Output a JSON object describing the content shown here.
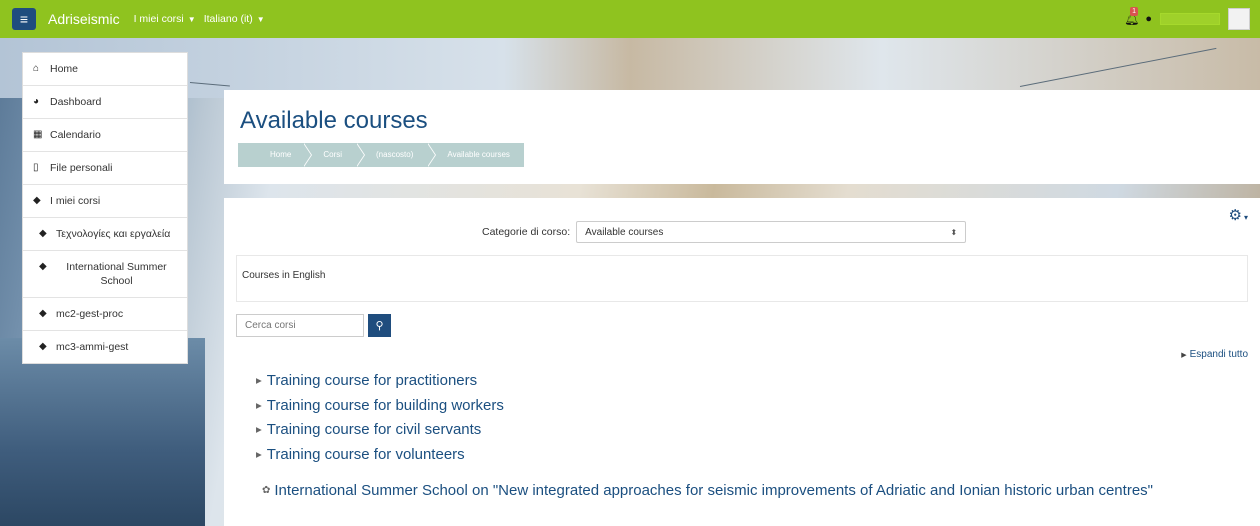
{
  "navbar": {
    "brand": "Adriseismic",
    "my_courses_label": "I miei corsi",
    "language_label": "Italiano (it)",
    "notification_count": "1",
    "colors": {
      "navbar_bg": "#8fc31f",
      "toggle_bg": "#1f4d7e"
    }
  },
  "sidebar": {
    "items": [
      {
        "label": "Home",
        "icon": "home-icon"
      },
      {
        "label": "Dashboard",
        "icon": "dashboard-icon"
      },
      {
        "label": "Calendario",
        "icon": "calendar-icon"
      },
      {
        "label": "File personali",
        "icon": "file-icon"
      },
      {
        "label": "I miei corsi",
        "icon": "graduation-cap-icon"
      },
      {
        "label": "Τεχνολογίες και εργαλεία",
        "icon": "graduation-cap-icon"
      },
      {
        "label": "International Summer School",
        "icon": "graduation-cap-icon"
      },
      {
        "label": "mc2-gest-proc",
        "icon": "graduation-cap-icon"
      },
      {
        "label": "mc3-ammi-gest",
        "icon": "graduation-cap-icon"
      }
    ]
  },
  "header": {
    "title": "Available courses",
    "breadcrumb": [
      "Home",
      "Corsi",
      "(nascosto)",
      "Available courses"
    ]
  },
  "main": {
    "category_label": "Categorie di corso:",
    "category_selected": "Available courses",
    "description": "Courses in English",
    "search_placeholder": "Cerca corsi",
    "expand_all": "Espandi tutto",
    "subcategories": [
      "Training course for practitioners",
      "Training course for building workers",
      "Training course for civil servants",
      "Training course for volunteers"
    ],
    "course": "International Summer School on \"New integrated approaches for seismic improvements of Adriatic and Ionian historic urban centres\"",
    "colors": {
      "link": "#1b4f80",
      "button": "#1f4d7e"
    }
  }
}
